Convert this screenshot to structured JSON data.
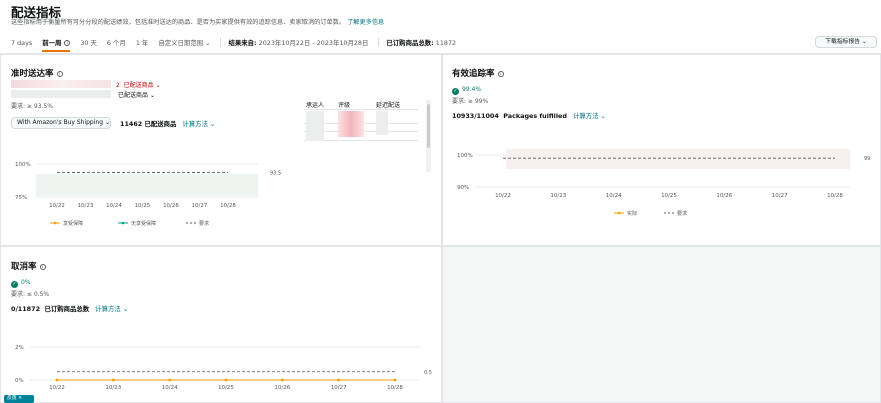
{
  "header": {
    "title": "配送指标",
    "subtitle": "这些指标用于衡量所有可分分段的配送绩效，包括准时送达的商品、是否为买家提供有效的追踪信息、卖家取消的订单数。",
    "learn_more": "了解更多信息",
    "tabs": [
      "7 days",
      "前一周",
      "30 天",
      "6 个月",
      "1 年",
      "自定义日期范围"
    ],
    "active_tab": "前一周",
    "result_label": "结果来自:",
    "result_range": "2023年10月22日 - 2023年10月28日",
    "orders_label": "已订购商品总数:",
    "orders_value": "11872",
    "download_label": "下载指标报告"
  },
  "on_time": {
    "title": "准时送达率",
    "shipped_label": "已配送商品",
    "shipped_prefix": "2",
    "shipped_label2": "已配送商品",
    "requirement": "要求: ≥ 93.5%",
    "select_label": "With Amazon's Buy Shipping",
    "shipped_count": "11462",
    "shipped_count_label": "已配送商品",
    "calc": "计算方法",
    "table_headers": [
      "承运人",
      "评级",
      "延迟配送"
    ],
    "legend": [
      "享受保障",
      "无享受保障",
      "要求"
    ]
  },
  "tracking": {
    "title": "有效追踪率",
    "value": "99.4%",
    "requirement": "要求: ≥ 99%",
    "counts": "10933/11004",
    "counts_label": "Packages fulfilled",
    "calc": "计算方法",
    "legend": [
      "实际",
      "要求"
    ]
  },
  "cancel": {
    "title": "取消率",
    "value": "0%",
    "requirement": "要求: ≤ 0.5%",
    "counts": "0/11872",
    "counts_label": "已订购商品总数",
    "calc": "计算方法"
  },
  "chip_label": "反馈",
  "colors": {
    "accent": "#e77600",
    "link": "#007185",
    "success": "#067d62",
    "teal": "#008296"
  },
  "chart_data": [
    {
      "type": "line",
      "title": "准时送达率",
      "categories": [
        "10/22",
        "10/23",
        "10/24",
        "10/25",
        "10/26",
        "10/27",
        "10/28"
      ],
      "y_ticks": [
        "100%",
        "75%"
      ],
      "ylim": [
        75,
        100
      ],
      "requirement": 93.5,
      "requirement_label": "93.5",
      "series": [
        {
          "name": "要求",
          "values": [
            93.5,
            93.5,
            93.5,
            93.5,
            93.5,
            93.5,
            93.5
          ]
        }
      ],
      "legend": [
        "享受保障",
        "无享受保障",
        "要求"
      ]
    },
    {
      "type": "line",
      "title": "有效追踪率",
      "categories": [
        "10/22",
        "10/23",
        "10/24",
        "10/25",
        "10/26",
        "10/27",
        "10/28"
      ],
      "y_ticks": [
        "100%",
        "90%"
      ],
      "ylim": [
        90,
        100
      ],
      "requirement": 99,
      "requirement_label": "99",
      "series": [
        {
          "name": "要求",
          "values": [
            99,
            99,
            99,
            99,
            99,
            99,
            99
          ]
        }
      ],
      "legend": [
        "实际",
        "要求"
      ]
    },
    {
      "type": "line",
      "title": "取消率",
      "categories": [
        "10/22",
        "10/23",
        "10/24",
        "10/25",
        "10/26",
        "10/27",
        "10/28"
      ],
      "y_ticks": [
        "2%",
        "0%"
      ],
      "ylim": [
        0,
        2
      ],
      "requirement": 0.5,
      "requirement_label": "0.5",
      "series": [
        {
          "name": "取消率",
          "values": [
            0,
            0,
            0,
            0,
            0,
            0,
            0
          ]
        },
        {
          "name": "要求",
          "values": [
            0.5,
            0.5,
            0.5,
            0.5,
            0.5,
            0.5,
            0.5
          ]
        }
      ]
    }
  ]
}
